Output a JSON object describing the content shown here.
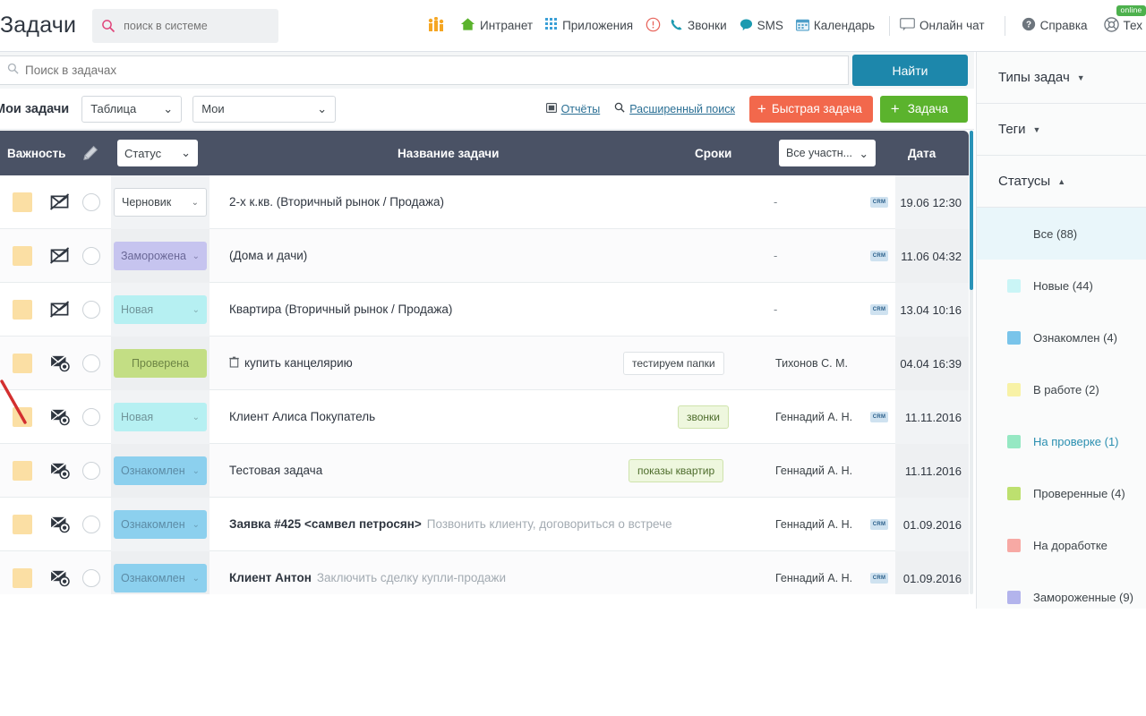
{
  "header": {
    "page_title": "Задачи",
    "global_search": {
      "placeholder": "поиск в системе",
      "value": "",
      "icon": "search-icon"
    },
    "nav": [
      {
        "label": "",
        "icon": "people-stats-icon",
        "name": "people-stats"
      },
      {
        "label": "Интранет",
        "icon": "home-icon",
        "name": "intranet"
      },
      {
        "label": "Приложения",
        "icon": "grid-apps-icon",
        "name": "apps"
      },
      {
        "label": "",
        "icon": "alert-circle-icon",
        "name": "alert"
      },
      {
        "label": "Звонки",
        "icon": "phone-icon",
        "name": "calls"
      },
      {
        "label": "SMS",
        "icon": "chat-bubble-icon",
        "name": "sms"
      },
      {
        "label": "Календарь",
        "icon": "calendar-icon",
        "name": "calendar"
      },
      {
        "label": "Онлайн чат",
        "icon": "speech-bubble-icon",
        "name": "online-chat"
      },
      {
        "label": "Справка",
        "icon": "question-circle-icon",
        "name": "help"
      },
      {
        "label": "Тех",
        "icon": "lifebuoy-icon",
        "name": "techsupport",
        "badge": "online"
      }
    ]
  },
  "search": {
    "placeholder": "Поиск в задачах",
    "value": "",
    "icon": "search-icon",
    "find_button": "Найти"
  },
  "toolbar": {
    "title": "Мои задачи",
    "view_select": {
      "value": "Таблица"
    },
    "scope_select": {
      "value": "Мои"
    },
    "reports_link": "Отчёты",
    "advanced_search_link": "Расширенный поиск",
    "quick_task_button": "Быстрая задача",
    "task_button": "Задача"
  },
  "table": {
    "columns": {
      "importance": "Важность",
      "pencil_icon": "pencil-icon",
      "status_filter": "Статус",
      "name": "Название задачи",
      "terms": "Сроки",
      "members_filter": "Все участн...",
      "date": "Дата"
    },
    "rows": [
      {
        "importance_color": "#fbdfa4",
        "envelope_icon": "envelope-crossed-icon",
        "status": {
          "label": "Черновик",
          "style": "boxed",
          "bg": "#ffffff",
          "fg": "#3d4449"
        },
        "name": "2-х к.кв. (Вторичный рынок / Продажа)",
        "desc": "",
        "tag": "",
        "terms": "-",
        "member": "",
        "crm": "CRM",
        "date": "19.06 12:30"
      },
      {
        "importance_color": "#fbdfa4",
        "envelope_icon": "envelope-crossed-icon",
        "status": {
          "label": "Заморожена",
          "style": "filled",
          "bg": "#c6c4ef",
          "fg": "#6a6897"
        },
        "name": "(Дома и дачи)",
        "desc": "",
        "tag": "",
        "terms": "-",
        "member": "",
        "crm": "CRM",
        "date": "11.06 04:32"
      },
      {
        "importance_color": "#fbdfa4",
        "envelope_icon": "envelope-crossed-icon",
        "status": {
          "label": "Новая",
          "style": "filled",
          "bg": "#b6f0f2",
          "fg": "#71959a"
        },
        "name": "Квартира (Вторичный рынок / Продажа)",
        "desc": "",
        "tag": "",
        "terms": "-",
        "member": "",
        "crm": "CRM",
        "date": "13.04 10:16"
      },
      {
        "importance_color": "#fbdfa4",
        "envelope_icon": "envelope-check-icon",
        "status": {
          "label": "Проверена",
          "style": "filled-center",
          "bg": "#c3de84",
          "fg": "#6d8545"
        },
        "name": "купить канцелярию",
        "name_icon": "trash-icon",
        "desc": "",
        "tag": "тестируем папки",
        "tag_style": "white",
        "terms": "",
        "member": "Тихонов С. М.",
        "crm": "",
        "date": "04.04 16:39"
      },
      {
        "importance_color": "#fbdfa4",
        "envelope_icon": "envelope-check-icon",
        "status": {
          "label": "Новая",
          "style": "filled",
          "bg": "#b6f0f2",
          "fg": "#71959a"
        },
        "name": "Клиент Алиса Покупатель",
        "desc": "",
        "tag": "звонки",
        "tag_style": "green",
        "terms": "",
        "member": "Геннадий А. Н.",
        "crm": "CRM",
        "date": "11.11.2016"
      },
      {
        "importance_color": "#fbdfa4",
        "envelope_icon": "envelope-check-icon",
        "status": {
          "label": "Ознакомлен",
          "style": "filled",
          "bg": "#8cd0ee",
          "fg": "#5c8ba5"
        },
        "name": "Тестовая задача",
        "desc": "",
        "tag": "показы квартир",
        "tag_style": "green",
        "terms": "",
        "member": "Геннадий А. Н.",
        "crm": "",
        "date": "11.11.2016"
      },
      {
        "importance_color": "#fbdfa4",
        "envelope_icon": "envelope-check-icon",
        "status": {
          "label": "Ознакомлен",
          "style": "filled",
          "bg": "#8cd0ee",
          "fg": "#5c8ba5"
        },
        "name": "Заявка #425 <самвел петросян>",
        "desc": "Позвонить клиенту, договориться о встрече",
        "tag": "",
        "terms": "",
        "member": "Геннадий А. Н.",
        "crm": "CRM",
        "date": "01.09.2016"
      },
      {
        "importance_color": "#fbdfa4",
        "envelope_icon": "envelope-check-icon",
        "status": {
          "label": "Ознакомлен",
          "style": "filled",
          "bg": "#8cd0ee",
          "fg": "#5c8ba5"
        },
        "name": "Клиент Антон",
        "desc": "Заключить сделку купли-продажи",
        "tag": "",
        "terms": "",
        "member": "Геннадий А. Н.",
        "crm": "CRM",
        "date": "01.09.2016"
      }
    ]
  },
  "sidebar": {
    "sections": [
      {
        "label": "Типы задач",
        "caret": "down",
        "name": "task-types"
      },
      {
        "label": "Теги",
        "caret": "down",
        "name": "tags"
      },
      {
        "label": "Статусы",
        "caret": "up",
        "name": "statuses"
      }
    ],
    "status_items": [
      {
        "label": "Все (88)",
        "color": "",
        "active": true,
        "link": false
      },
      {
        "label": "Новые (44)",
        "color": "#caf5f6",
        "active": false,
        "link": false
      },
      {
        "label": "Ознакомлен (4)",
        "color": "#79c4ea",
        "active": false,
        "link": false
      },
      {
        "label": "В работе (2)",
        "color": "#f8f2a6",
        "active": false,
        "link": false
      },
      {
        "label": "На проверке (1)",
        "color": "#96e8c3",
        "active": false,
        "link": true
      },
      {
        "label": "Проверенные (4)",
        "color": "#bde06f",
        "active": false,
        "link": false
      },
      {
        "label": "На доработке",
        "color": "#f7a9a4",
        "active": false,
        "link": false
      },
      {
        "label": "Замороженные (9)",
        "color": "#b3b4ec",
        "active": false,
        "link": false
      }
    ]
  },
  "colors": {
    "header_bg": "#4a5265",
    "accent_blue": "#1d87ab",
    "orange": "#f2684c",
    "green": "#5bb32d",
    "scrollbar": "#2a93b8"
  }
}
